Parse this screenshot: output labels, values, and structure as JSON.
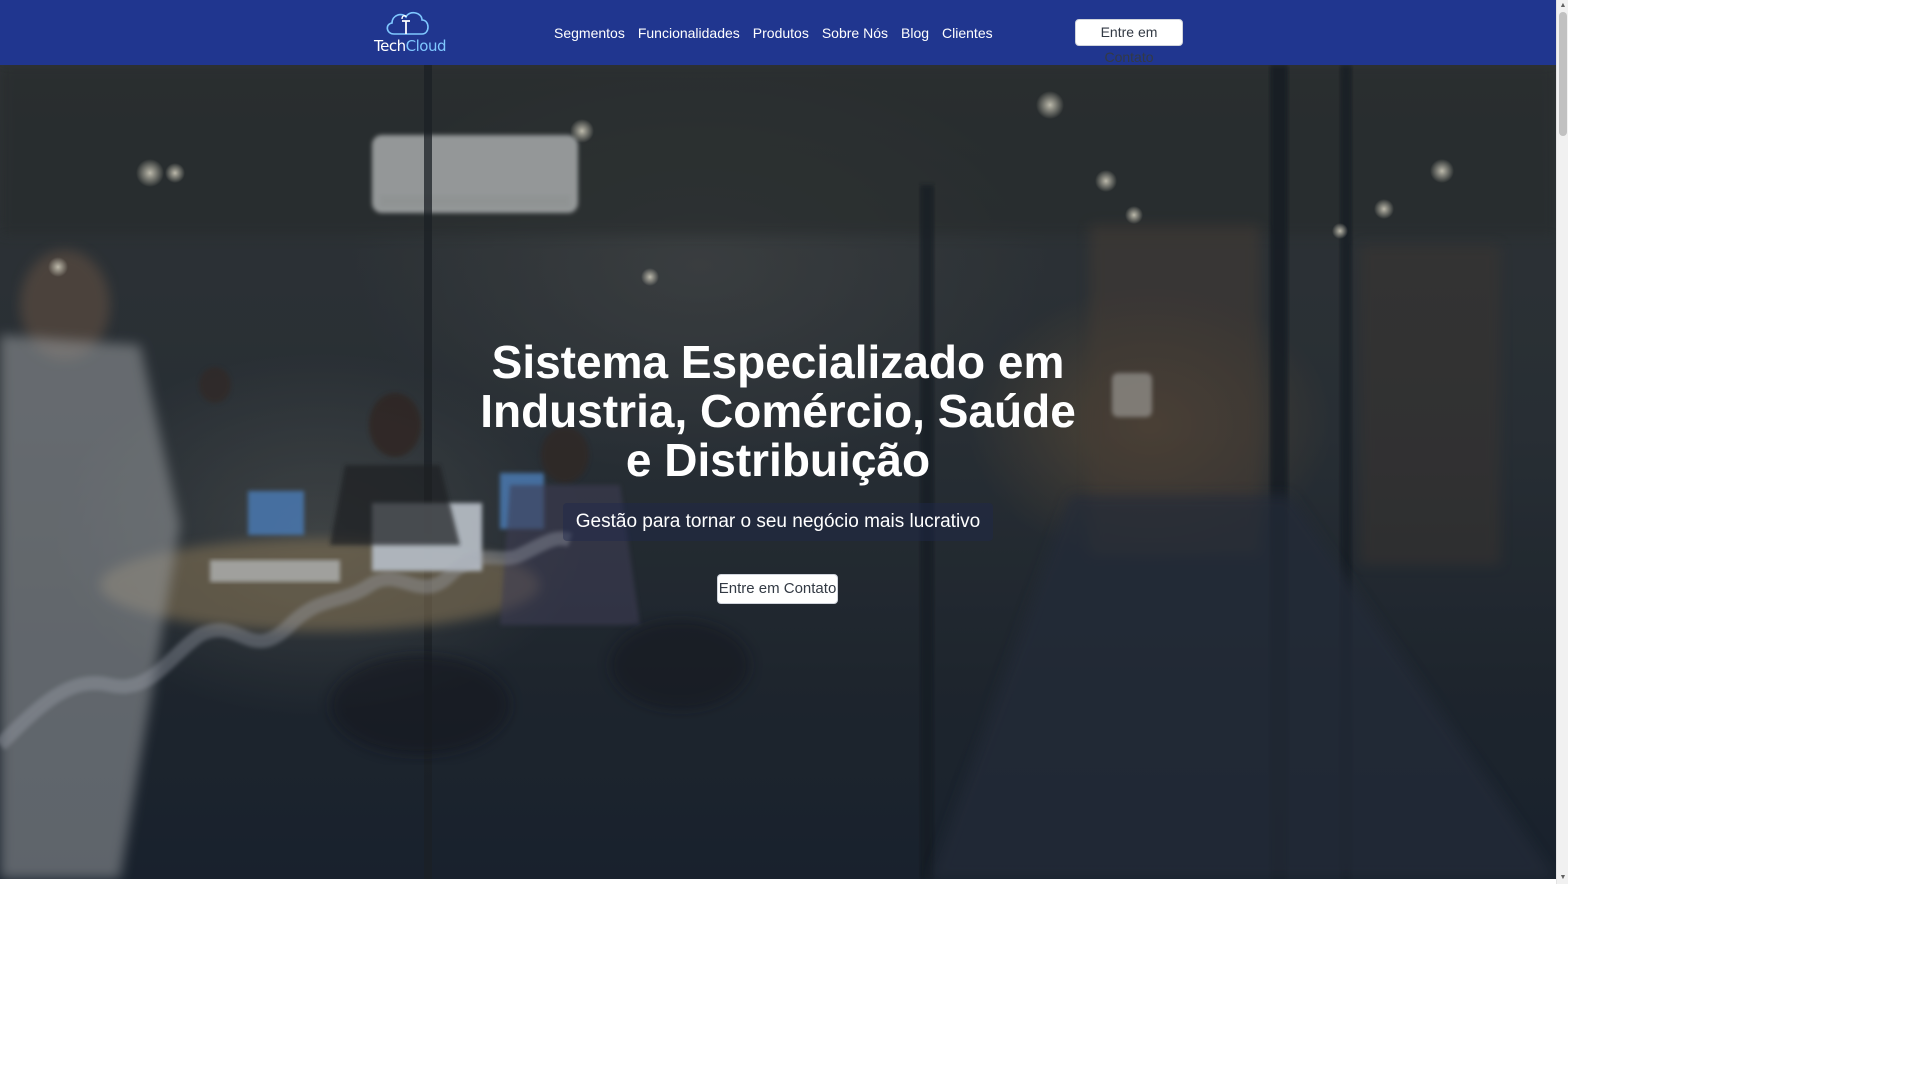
{
  "navbar": {
    "logo": {
      "text_main": "Tech",
      "text_accent": "Cloud",
      "icon": "cloud-icon"
    },
    "menu": [
      {
        "label": "Segmentos"
      },
      {
        "label": "Funcionalidades"
      },
      {
        "label": "Produtos"
      },
      {
        "label": "Sobre Nós"
      },
      {
        "label": "Blog"
      },
      {
        "label": "Clientes"
      }
    ],
    "cta_label": "Entre em Contato"
  },
  "hero": {
    "title_line1": "Sistema Especializado em",
    "title_line2": "Industria, Comércio, Saúde",
    "title_line3": "e Distribuição",
    "subtitle": "Gestão para tornar o seu negócio mais lucrativo",
    "cta_label": "Entre em Contato",
    "background": "office-meeting-photo"
  },
  "colors": {
    "navbar_bg": "#20368f",
    "logo_accent": "#7fc8ff",
    "button_bg": "#ffffff",
    "button_text": "#333a44",
    "hero_text": "#ffffff"
  },
  "scrollbar": {
    "up_icon": "triangle-up-icon",
    "down_icon": "triangle-down-icon"
  }
}
